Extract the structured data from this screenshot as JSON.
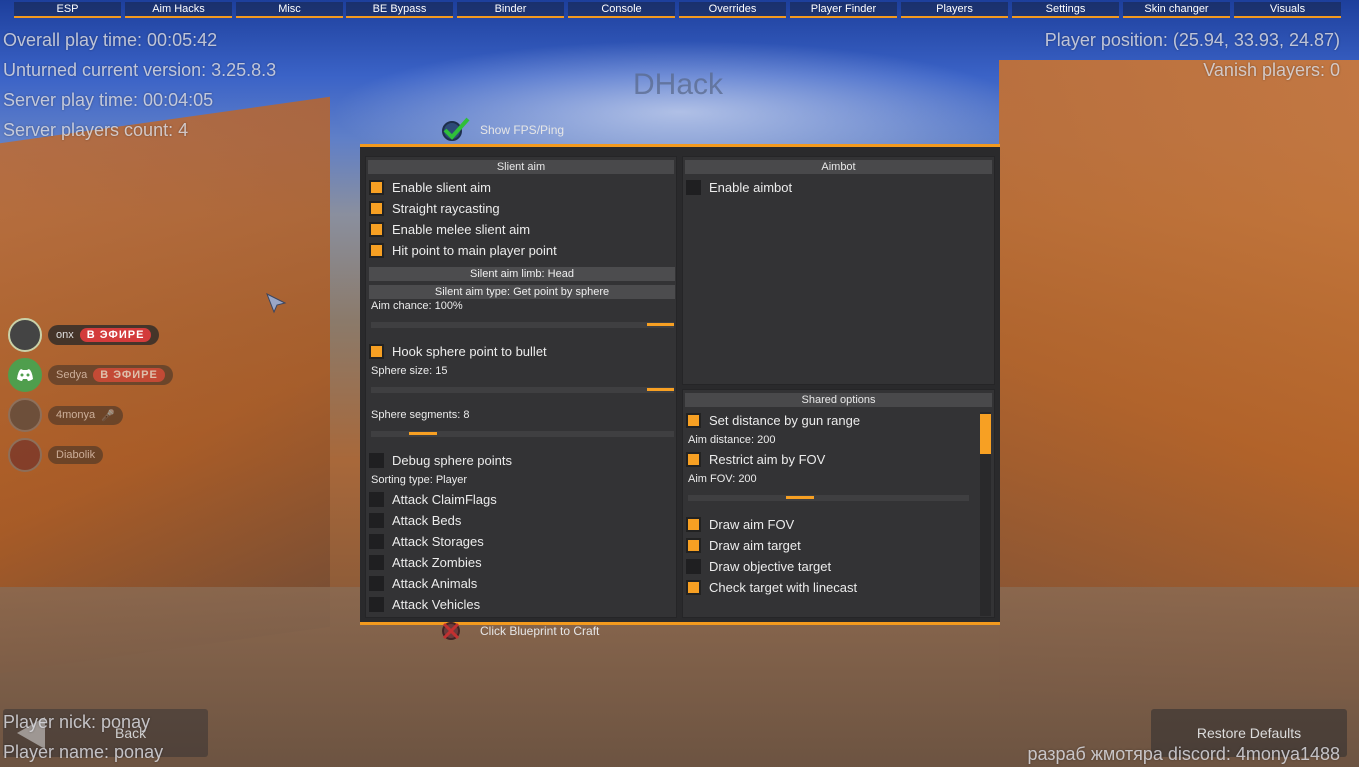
{
  "tabs": [
    "ESP",
    "Aim Hacks",
    "Misc",
    "BE Bypass",
    "Binder",
    "Console",
    "Overrides",
    "Player Finder",
    "Players",
    "Settings",
    "Skin changer",
    "Visuals"
  ],
  "hud": {
    "overall_play_time": "Overall play time: 00:05:42",
    "version": "Unturned current version: 3.25.8.3",
    "server_play_time": "Server play time: 00:04:05",
    "server_players": "Server players count: 4",
    "player_position": "Player position: (25.94, 33.93, 24.87)",
    "vanish_players": "Vanish players: 0",
    "brand": "DHack",
    "player_nick": "Player nick: ponay",
    "player_name": "Player name: ponay",
    "credits": "разраб жмотяра discord: 4monya1488"
  },
  "overlay": {
    "show_fps": "Show FPS/Ping",
    "click_blueprint": "Click Blueprint to Craft"
  },
  "voice": [
    {
      "name": "onx",
      "live": "В ЭФИРЕ"
    },
    {
      "name": "Sedya",
      "live": "В ЭФИРЕ"
    },
    {
      "name": "4monya",
      "live": ""
    },
    {
      "name": "Diabolik",
      "live": ""
    }
  ],
  "silent_aim": {
    "header": "Slient aim",
    "enable": {
      "label": "Enable slient aim",
      "checked": true
    },
    "straight": {
      "label": "Straight raycasting",
      "checked": true
    },
    "melee": {
      "label": "Enable melee slient aim",
      "checked": true
    },
    "hitpoint": {
      "label": "Hit point to main player point",
      "checked": true
    },
    "limb_btn": "Silent aim limb: Head",
    "type_btn": "Silent aim type: Get point by sphere",
    "aim_chance": "Aim chance: 100%",
    "aim_chance_value": 1.0,
    "hook_sphere": {
      "label": "Hook sphere point to bullet",
      "checked": true
    },
    "sphere_size": "Sphere size: 15",
    "sphere_size_value": 1.0,
    "sphere_segments": "Sphere segments: 8",
    "sphere_segments_value": 0.18,
    "debug_sphere": {
      "label": "Debug sphere points",
      "checked": false
    },
    "sorting_type": "Sorting type: Player",
    "attack_claimflags": {
      "label": "Attack ClaimFlags",
      "checked": false
    },
    "attack_beds": {
      "label": "Attack Beds",
      "checked": false
    },
    "attack_storages": {
      "label": "Attack Storages",
      "checked": false
    },
    "attack_zombies": {
      "label": "Attack Zombies",
      "checked": false
    },
    "attack_animals": {
      "label": "Attack Animals",
      "checked": false
    },
    "attack_vehicles": {
      "label": "Attack Vehicles",
      "checked": false
    }
  },
  "aimbot": {
    "header": "Aimbot",
    "enable": {
      "label": "Enable aimbot",
      "checked": false
    }
  },
  "shared": {
    "header": "Shared options",
    "set_distance": {
      "label": "Set distance by gun range",
      "checked": true
    },
    "aim_distance": "Aim distance: 200",
    "restrict_fov": {
      "label": "Restrict aim by FOV",
      "checked": true
    },
    "aim_fov": "Aim FOV: 200",
    "aim_fov_value": 0.5,
    "draw_fov": {
      "label": "Draw aim FOV",
      "checked": true
    },
    "draw_target": {
      "label": "Draw aim target",
      "checked": true
    },
    "draw_objective": {
      "label": "Draw objective target",
      "checked": false
    },
    "check_linecast": {
      "label": "Check target with linecast",
      "checked": true
    }
  },
  "buttons": {
    "restore": "Restore Defaults",
    "back": "Back"
  },
  "colors": {
    "accent": "#f39a1e",
    "panel": "#2a2a2c"
  }
}
